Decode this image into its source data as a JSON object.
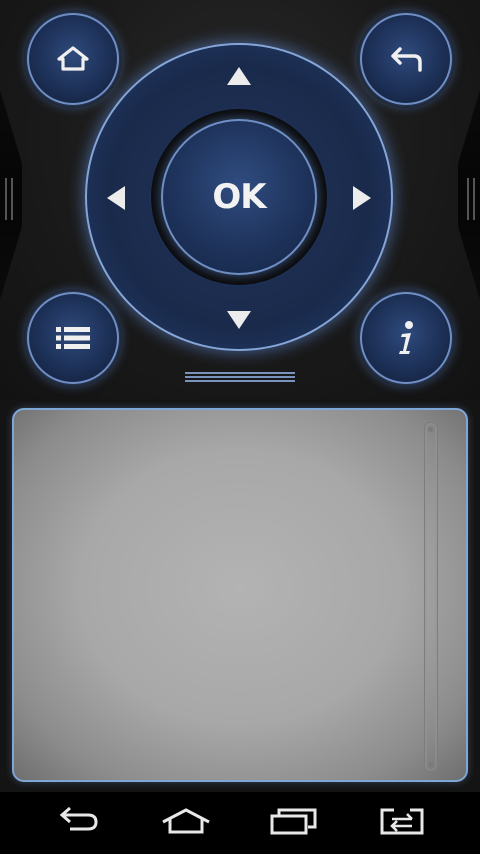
{
  "remote": {
    "ok_label": "OK",
    "buttons": {
      "home": "home-icon",
      "back": "back-arrow-icon",
      "menu": "list-menu-icon",
      "info": "info-icon"
    },
    "accent_color": "#6f8fc4",
    "button_fill": "#1d3158"
  },
  "touchpad": {
    "border_color": "#7fa7d6",
    "surface_color": "#a8a8a8"
  },
  "navbar": {
    "items": [
      "back-icon",
      "home-icon",
      "recent-apps-icon",
      "switch-display-icon"
    ]
  }
}
